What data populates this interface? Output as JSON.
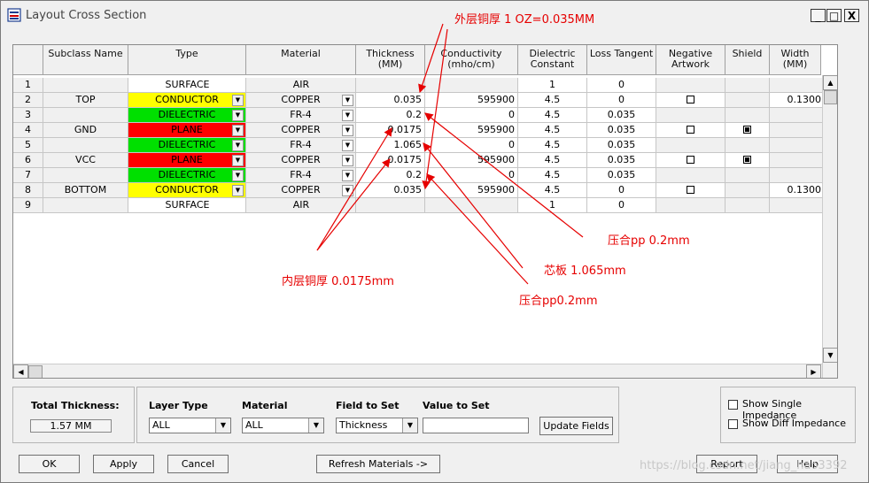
{
  "window": {
    "title": "Layout Cross Section",
    "min_label": "_",
    "max_label": "□",
    "close_label": "X"
  },
  "columns": [
    "",
    "Subclass Name",
    "Type",
    "Material",
    "Thickness\n(MM)",
    "Conductivity\n(mho/cm)",
    "Dielectric\nConstant",
    "Loss Tangent",
    "Negative\nArtwork",
    "Shield",
    "Width\n(MM)"
  ],
  "rows": [
    {
      "num": "1",
      "subclass": "",
      "type": "SURFACE",
      "type_color": "#ffffff",
      "material": "AIR",
      "mat_dd": false,
      "type_dd": false,
      "thickness": "",
      "conductivity": "",
      "dielectric": "1",
      "loss": "0",
      "neg": null,
      "shield": null,
      "width": ""
    },
    {
      "num": "2",
      "subclass": "TOP",
      "type": "CONDUCTOR",
      "type_color": "#ffff00",
      "material": "COPPER",
      "mat_dd": true,
      "type_dd": true,
      "thickness": "0.035",
      "conductivity": "595900",
      "dielectric": "4.5",
      "loss": "0",
      "neg": false,
      "shield": null,
      "width": "0.1300"
    },
    {
      "num": "3",
      "subclass": "",
      "type": "DIELECTRIC",
      "type_color": "#00e000",
      "material": "FR-4",
      "mat_dd": true,
      "type_dd": true,
      "thickness": "0.2",
      "conductivity": "0",
      "dielectric": "4.5",
      "loss": "0.035",
      "neg": null,
      "shield": null,
      "width": ""
    },
    {
      "num": "4",
      "subclass": "GND",
      "type": "PLANE",
      "type_color": "#ff0000",
      "material": "COPPER",
      "mat_dd": true,
      "type_dd": true,
      "thickness": "0.0175",
      "conductivity": "595900",
      "dielectric": "4.5",
      "loss": "0.035",
      "neg": false,
      "shield": true,
      "width": ""
    },
    {
      "num": "5",
      "subclass": "",
      "type": "DIELECTRIC",
      "type_color": "#00e000",
      "material": "FR-4",
      "mat_dd": true,
      "type_dd": true,
      "thickness": "1.065",
      "conductivity": "0",
      "dielectric": "4.5",
      "loss": "0.035",
      "neg": null,
      "shield": null,
      "width": ""
    },
    {
      "num": "6",
      "subclass": "VCC",
      "type": "PLANE",
      "type_color": "#ff0000",
      "material": "COPPER",
      "mat_dd": true,
      "type_dd": true,
      "thickness": "0.0175",
      "conductivity": "595900",
      "dielectric": "4.5",
      "loss": "0.035",
      "neg": false,
      "shield": true,
      "width": ""
    },
    {
      "num": "7",
      "subclass": "",
      "type": "DIELECTRIC",
      "type_color": "#00e000",
      "material": "FR-4",
      "mat_dd": true,
      "type_dd": true,
      "thickness": "0.2",
      "conductivity": "0",
      "dielectric": "4.5",
      "loss": "0.035",
      "neg": null,
      "shield": null,
      "width": ""
    },
    {
      "num": "8",
      "subclass": "BOTTOM",
      "type": "CONDUCTOR",
      "type_color": "#ffff00",
      "material": "COPPER",
      "mat_dd": true,
      "type_dd": true,
      "thickness": "0.035",
      "conductivity": "595900",
      "dielectric": "4.5",
      "loss": "0",
      "neg": false,
      "shield": null,
      "width": "0.1300"
    },
    {
      "num": "9",
      "subclass": "",
      "type": "SURFACE",
      "type_color": "#ffffff",
      "material": "AIR",
      "mat_dd": false,
      "type_dd": false,
      "thickness": "",
      "conductivity": "",
      "dielectric": "1",
      "loss": "0",
      "neg": null,
      "shield": null,
      "width": ""
    }
  ],
  "total": {
    "label": "Total Thickness:",
    "value": "1.57 MM"
  },
  "fields": {
    "layer_type_label": "Layer Type",
    "layer_type_value": "ALL",
    "material_label": "Material",
    "material_value": "ALL",
    "field_label": "Field to Set",
    "field_value": "Thickness",
    "value_label": "Value to Set",
    "value_value": "",
    "update_button": "Update Fields"
  },
  "impedance": {
    "single": "Show Single Impedance",
    "diff": "Show Diff Impedance"
  },
  "buttons": {
    "ok": "OK",
    "apply": "Apply",
    "cancel": "Cancel",
    "refresh": "Refresh Materials ->",
    "report": "Report",
    "help": "Help"
  },
  "annotations": {
    "outer_copper": "外层铜厚 1 OZ=0.035MM",
    "pp1": "压合pp 0.2mm",
    "core": "芯板 1.065mm",
    "inner_copper": "内层铜厚 0.0175mm",
    "pp2": "压合pp0.2mm"
  },
  "watermark": "https://blog.csdn.net/jiang_hao3392",
  "colors": {
    "conductor": "#ffff00",
    "dielectric": "#00e000",
    "plane": "#ff0000",
    "annotation": "#e60000"
  }
}
